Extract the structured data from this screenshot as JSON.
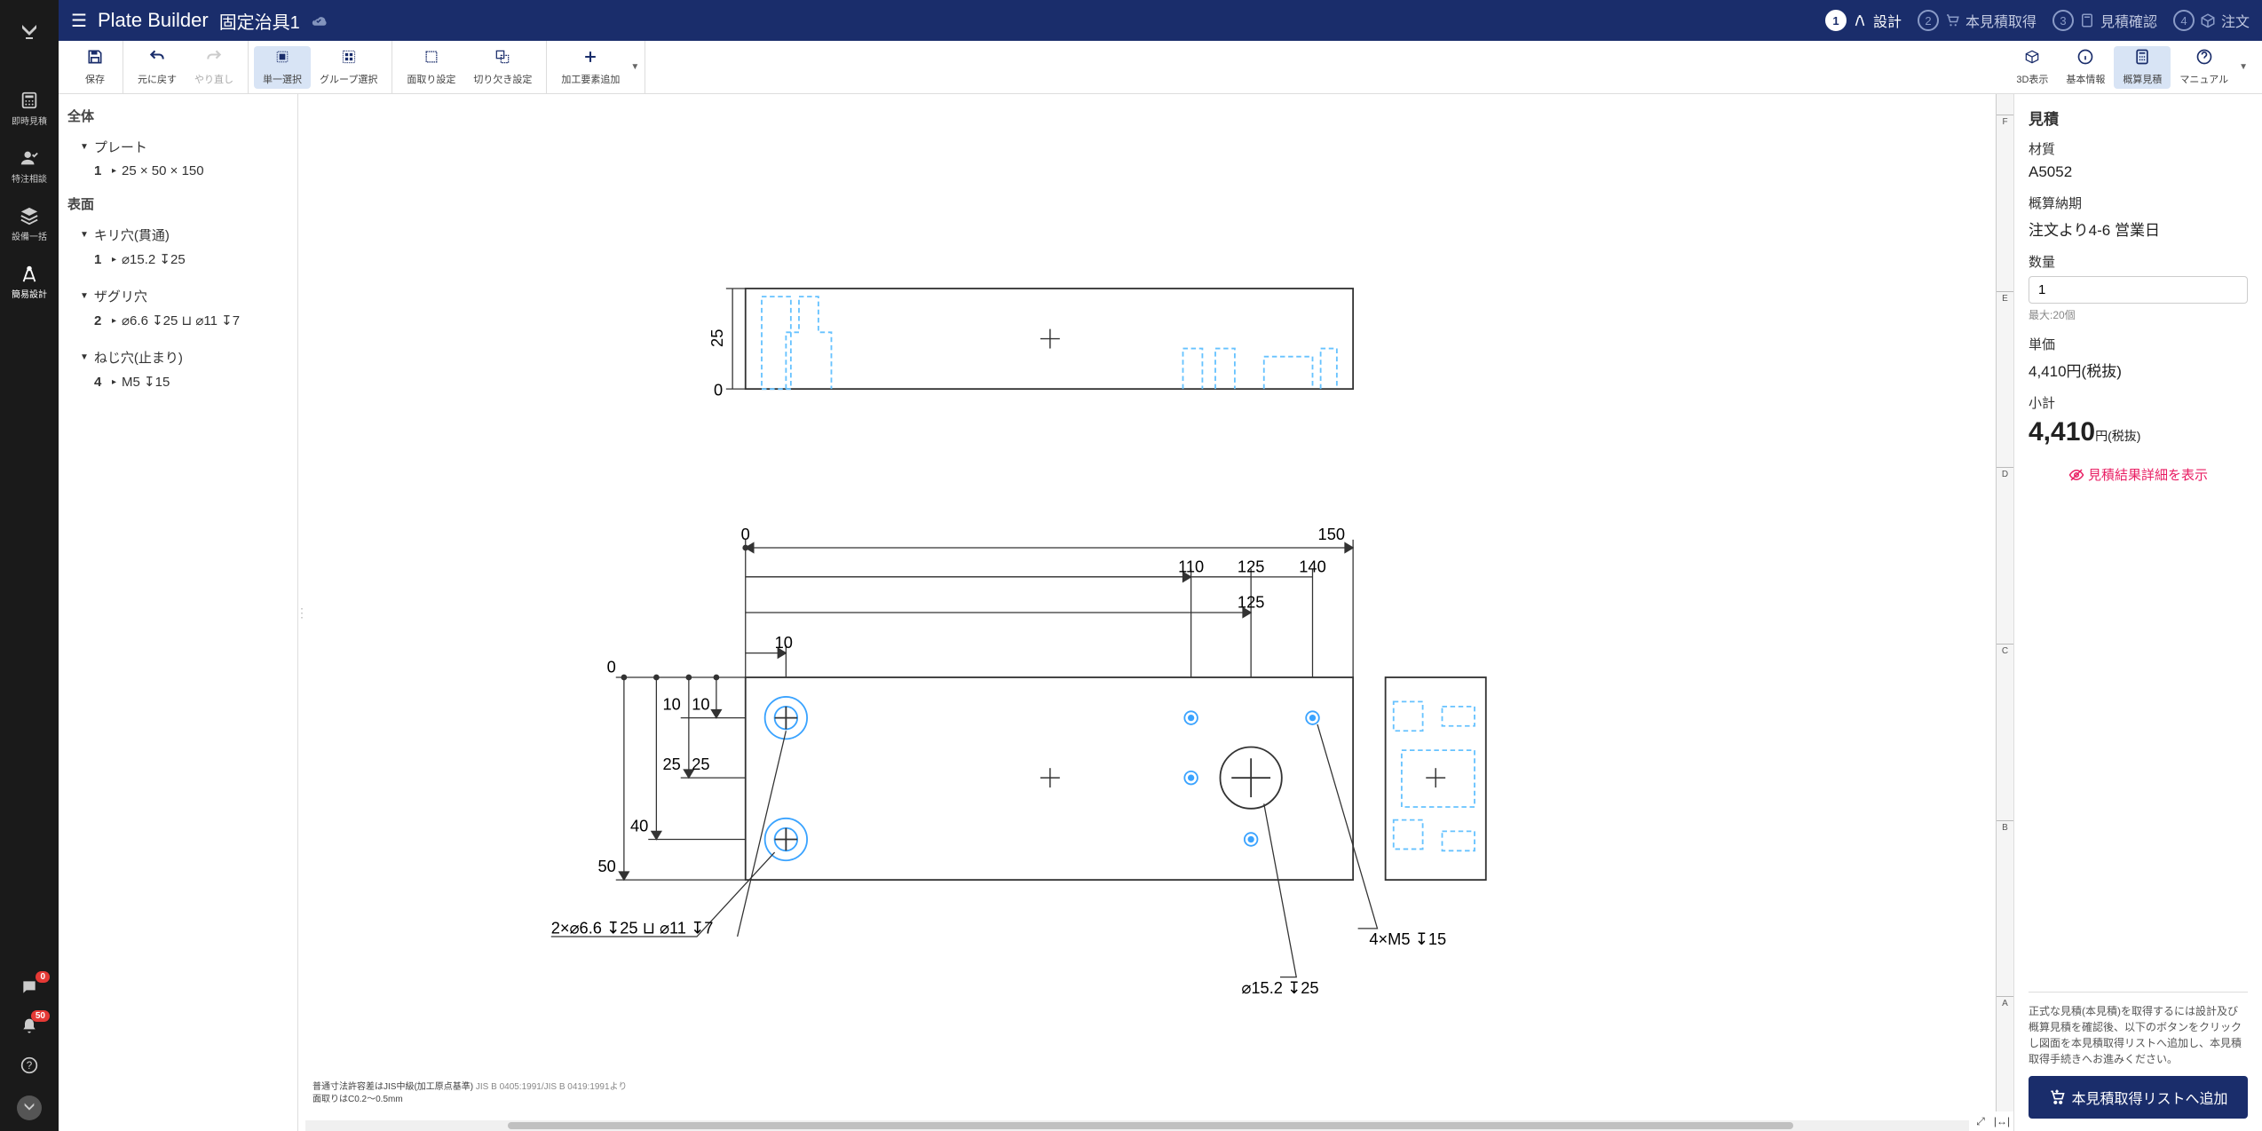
{
  "rail": {
    "items": [
      {
        "label": "即時見積"
      },
      {
        "label": "特注相談"
      },
      {
        "label": "設備一括"
      },
      {
        "label": "簡易設計"
      }
    ],
    "chat_badge": "0",
    "notif_badge": "50"
  },
  "header": {
    "title": "Plate Builder",
    "subtitle": "固定治具1",
    "steps": [
      {
        "num": "1",
        "label": "設計"
      },
      {
        "num": "2",
        "label": "本見積取得"
      },
      {
        "num": "3",
        "label": "見積確認"
      },
      {
        "num": "4",
        "label": "注文"
      }
    ]
  },
  "toolbar": {
    "save": "保存",
    "undo": "元に戻す",
    "redo": "やり直し",
    "single_select": "単一選択",
    "group_select": "グループ選択",
    "chamfer": "面取り設定",
    "cutout": "切り欠き設定",
    "add_feature": "加工要素追加",
    "view_3d": "3D表示",
    "basic_info": "基本情報",
    "rough_estimate": "概算見積",
    "manual": "マニュアル"
  },
  "tree": {
    "h_all": "全体",
    "plate_label": "プレート",
    "plate_item_num": "1",
    "plate_item_text": "25 × 50 × 150",
    "h_surface": "表面",
    "drill_label": "キリ穴(貫通)",
    "drill_num": "1",
    "drill_text": "⌀15.2 ↧25",
    "cbore_label": "ザグリ穴",
    "cbore_num": "2",
    "cbore_text": "⌀6.6 ↧25 ⊔ ⌀11 ↧7",
    "tap_label": "ねじ穴(止まり)",
    "tap_num": "4",
    "tap_text": "M5 ↧15"
  },
  "drawing": {
    "dims": {
      "h25": "25",
      "zero1": "0",
      "zero2": "0",
      "zero3": "0",
      "w150": "150",
      "w140": "140",
      "w125a": "125",
      "w125b": "125",
      "w110": "110",
      "w10": "10",
      "v10a": "10",
      "v10b": "10",
      "v25a": "25",
      "v25b": "25",
      "v40": "40",
      "v50": "50"
    },
    "callouts": {
      "cbore": "2×⌀6.6 ↧25 ⊔ ⌀11 ↧7",
      "drill": "⌀15.2 ↧25",
      "tap": "4×M5 ↧15"
    },
    "ruler_labels": [
      "F",
      "E",
      "D",
      "C",
      "B",
      "A"
    ],
    "footer1": "普通寸法許容差はJIS中級(加工原点基準)",
    "footer1b": "JIS B 0405:1991/JIS B 0419:1991より",
    "footer2": "面取りはC0.2〜0.5mm"
  },
  "estimate": {
    "title": "見積",
    "material_label": "材質",
    "material_value": "A5052",
    "leadtime_label": "概算納期",
    "leadtime_value": "注文より4-6 営業日",
    "qty_label": "数量",
    "qty_value": "1",
    "qty_note": "最大:20個",
    "unit_label": "単価",
    "unit_value": "4,410円(税抜)",
    "subtotal_label": "小計",
    "subtotal_value": "4,410",
    "subtotal_suffix": "円(税抜)",
    "detail_link": "見積結果詳細を表示",
    "note": "正式な見積(本見積)を取得するには設計及び概算見積を確認後、以下のボタンをクリックし図面を本見積取得リストへ追加し、本見積取得手続きへお進みください。",
    "cta": "本見積取得リストへ追加"
  }
}
